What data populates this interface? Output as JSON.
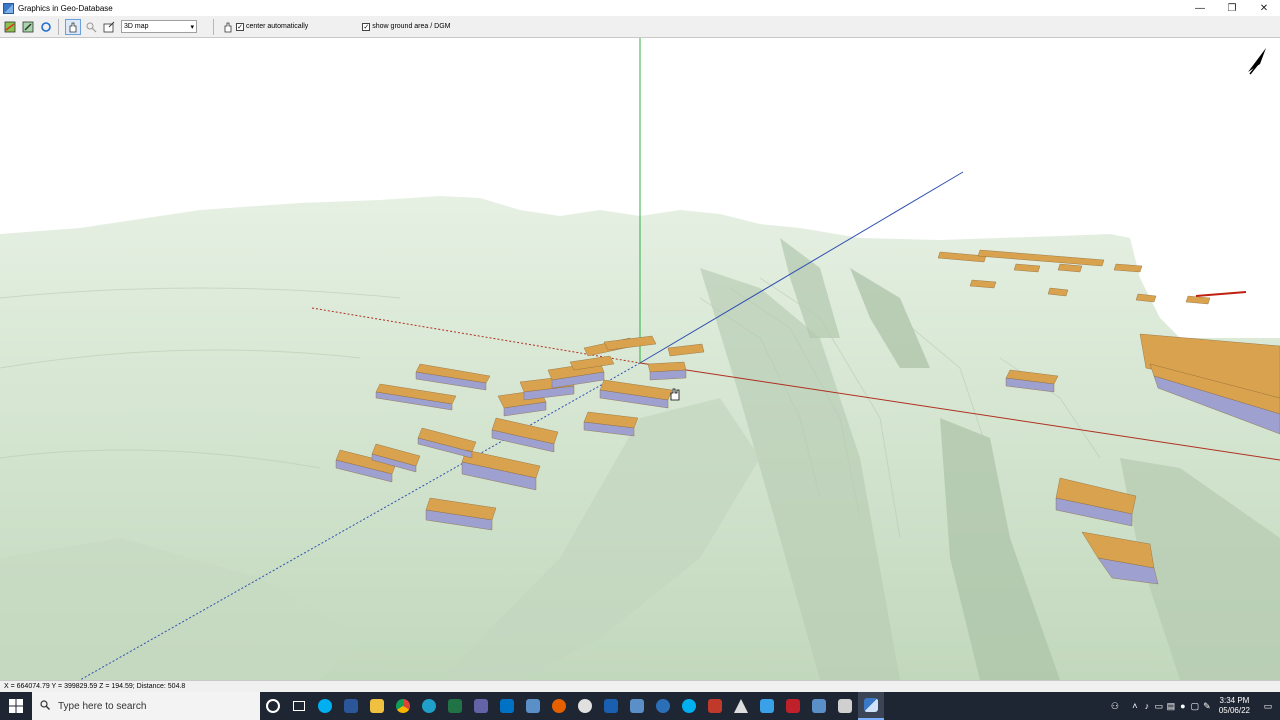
{
  "window": {
    "title": "Graphics in Geo-Database",
    "minimize": "—",
    "restore": "❐",
    "close": "✕"
  },
  "toolbar": {
    "view_mode": "3D map",
    "center_auto_label": "center automatically",
    "center_auto_checked": true,
    "ground_area_label": "show ground area / DGM",
    "ground_area_checked": true
  },
  "status": {
    "coords": "X = 664074.79   Y = 399829.59   Z = 194.59;   Distance: 504.8"
  },
  "taskbar": {
    "search_placeholder": "Type here to search",
    "time": "3:34 PM",
    "date": "05/06/22",
    "apps": [
      "cortana-icon",
      "task-view-icon",
      "skype-icon",
      "word-icon",
      "file-explorer-icon",
      "chrome-icon",
      "edge-icon",
      "excel-icon",
      "teams-icon",
      "outlook-icon",
      "sharepoint-icon",
      "firefox-icon",
      "app-icon",
      "powershell-icon",
      "sharepoint-icon",
      "app-icon",
      "skype-icon",
      "app-icon",
      "app-icon",
      "app-icon",
      "app-icon",
      "app-icon",
      "sharepoint-icon",
      "app-icon",
      "geo-database-icon"
    ]
  },
  "colors": {
    "terrain": "#d9e8d6",
    "roof": "#d9a24e",
    "wall": "#9ea0d0",
    "axis_x": "#b03020",
    "axis_y": "#3050b0",
    "axis_z": "#30b040"
  }
}
